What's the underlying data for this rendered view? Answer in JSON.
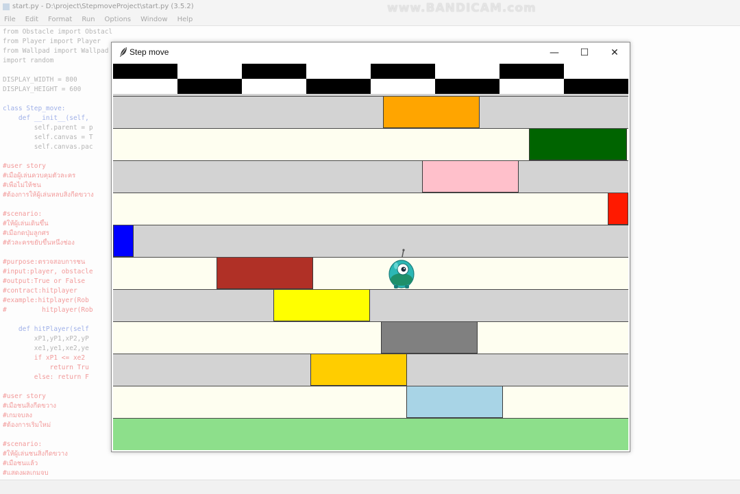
{
  "editor": {
    "title": "start.py - D:\\project\\StepmoveProject\\start.py (3.5.2)",
    "watermark": "www.BANDICAM.com",
    "menu": [
      "File",
      "Edit",
      "Format",
      "Run",
      "Options",
      "Window",
      "Help"
    ],
    "code_lines": [
      {
        "t": "from Obstacle import Obstacle",
        "k": "txt"
      },
      {
        "t": "from Player import Player",
        "k": "txt"
      },
      {
        "t": "from Wallpad import Wallpad",
        "k": "txt"
      },
      {
        "t": "import random",
        "k": "txt"
      },
      {
        "t": "",
        "k": "txt"
      },
      {
        "t": "DISPLAY_WIDTH = 800",
        "k": "txt"
      },
      {
        "t": "DISPLAY_HEIGHT = 600",
        "k": "txt"
      },
      {
        "t": "",
        "k": "txt"
      },
      {
        "t": "class Step_move:",
        "k": "def"
      },
      {
        "t": "    def __init__(self,",
        "k": "def"
      },
      {
        "t": "        self.parent = p",
        "k": "txt"
      },
      {
        "t": "        self.canvas = T",
        "k": "txt"
      },
      {
        "t": "        self.canvas.pac",
        "k": "txt"
      },
      {
        "t": "",
        "k": "txt"
      },
      {
        "t": "#user story",
        "k": "com"
      },
      {
        "t": "#เมื่อผู้เล่นควบคุมตัวละคร",
        "k": "com"
      },
      {
        "t": "#เพื่อไม่ให้ชน",
        "k": "com"
      },
      {
        "t": "#ต้องการให้ผู้เล่นหลบสิ่งกีดขวาง",
        "k": "com"
      },
      {
        "t": "",
        "k": "txt"
      },
      {
        "t": "#scenario:",
        "k": "com"
      },
      {
        "t": "#ให้ผู้เล่นเดินขึ้น",
        "k": "com"
      },
      {
        "t": "#เมื่อกดปุ่มลูกศร",
        "k": "com"
      },
      {
        "t": "#ตัวละครขยับขึ้นหนึ่งช่อง",
        "k": "com"
      },
      {
        "t": "",
        "k": "txt"
      },
      {
        "t": "#purpose:ตรวจสอบการชน",
        "k": "com"
      },
      {
        "t": "#input:player, obstacle",
        "k": "com"
      },
      {
        "t": "#output:True or False",
        "k": "com"
      },
      {
        "t": "#contract:hitplayer",
        "k": "com"
      },
      {
        "t": "#example:hitplayer(Rob",
        "k": "com"
      },
      {
        "t": "#         hitplayer(Rob",
        "k": "com"
      },
      {
        "t": "",
        "k": "txt"
      },
      {
        "t": "    def hitPlayer(self",
        "k": "def"
      },
      {
        "t": "        xP1,yP1,xP2,yP",
        "k": "txt"
      },
      {
        "t": "        xe1,ye1,xe2,ye",
        "k": "txt"
      },
      {
        "t": "        if xP1 <= xe2",
        "k": "kw"
      },
      {
        "t": "            return Tru",
        "k": "kw"
      },
      {
        "t": "        else: return F",
        "k": "kw"
      },
      {
        "t": "",
        "k": "txt"
      },
      {
        "t": "#user story",
        "k": "com"
      },
      {
        "t": "#เมื่อชนสิ่งกีดขวาง",
        "k": "com"
      },
      {
        "t": "#เกมจบลง",
        "k": "com"
      },
      {
        "t": "#ต้องการเริ่มใหม่",
        "k": "com"
      },
      {
        "t": "",
        "k": "txt"
      },
      {
        "t": "#scenario:",
        "k": "com"
      },
      {
        "t": "#ให้ผู้เล่นชนสิ่งกีดขวาง",
        "k": "com"
      },
      {
        "t": "#เมื่อชนแล้ว",
        "k": "com"
      },
      {
        "t": "#แสดงผลเกมจบ",
        "k": "com"
      }
    ]
  },
  "window": {
    "title": "Step move",
    "minimize_glyph": "—",
    "maximize_glyph": "☐",
    "close_glyph": "✕"
  },
  "game": {
    "lane_colors": {
      "gray": "#d3d3d3",
      "cream": "#fefef0"
    },
    "lanes": [
      {
        "bg": "gray",
        "block_color": "#ffa500"
      },
      {
        "bg": "cream",
        "block_color": "#006400"
      },
      {
        "bg": "gray",
        "block_color": "#ffc0cb"
      },
      {
        "bg": "cream",
        "block_color": "#ff1a00"
      },
      {
        "bg": "gray",
        "block_color": "#0000ff"
      },
      {
        "bg": "cream",
        "block_color": "#b03026"
      },
      {
        "bg": "gray",
        "block_color": "#ffff00"
      },
      {
        "bg": "cream",
        "block_color": "#808080"
      },
      {
        "bg": "gray",
        "block_color": "#ffcd00"
      },
      {
        "bg": "cream",
        "block_color": "#a8d4e6"
      }
    ],
    "finish_colors": [
      "#000000",
      "#ffffff"
    ],
    "grass_color": "#8ddf8b",
    "player_icon": "green-robot-character"
  }
}
